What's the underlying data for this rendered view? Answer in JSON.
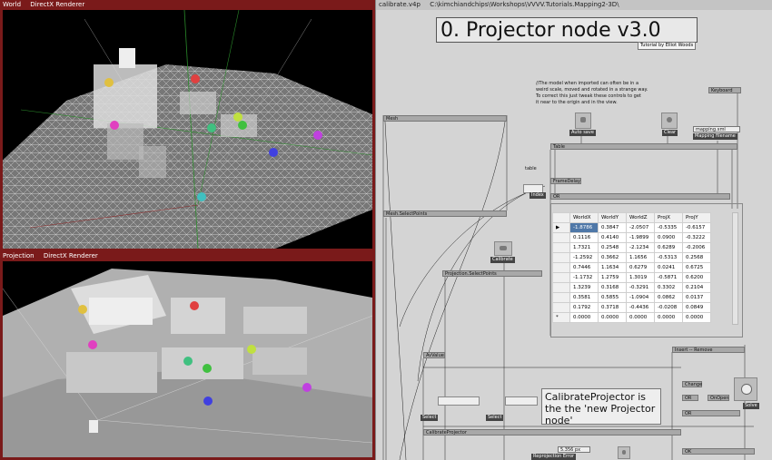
{
  "world_window": {
    "title": "World",
    "renderer": "DirectX Renderer"
  },
  "projection_window": {
    "title": "Projection",
    "renderer": "DirectX Renderer"
  },
  "patch_window": {
    "title": "calibrate.v4p",
    "path": "C:\\kimchiandchips\\Workshops\\VVVV.Tutorials.Mapping2-3D\\"
  },
  "patch": {
    "heading": "0. Projector node v3.0",
    "tutorial_by": "Tutorial by Elliot Woods",
    "comment_lines": [
      "//The model when imported can often be in a",
      "weird scale, moved and rotated in a strange way.",
      "To correct this just tweak these controls to get",
      "it near to the origin and in the view."
    ],
    "nodes": {
      "keyboard": "Keyboard",
      "mesh": "Mesh",
      "auto_save": "Auto save",
      "clear": "Clear",
      "mapping_file": "mapping.xml",
      "mapping_filename": "Mapping filename",
      "table": "Table",
      "table_label": "table",
      "frame_delay": "FrameDelay",
      "or_1": "OR",
      "index": "Index",
      "mesh_select": "Mesh.SelectPoints",
      "calibrate": "Calibrate",
      "proj_select": "Projection.SelectPoints",
      "insert_remove": "Insert -- Remove",
      "av_value": "AvValue",
      "select_1": "Select",
      "select_2": "Select",
      "calibrate_projector": "CalibrateProjector",
      "change": "Change",
      "or_2": "OR",
      "onopen": "OnOpen",
      "or_3": "OR",
      "solve": "Solve",
      "ok": "OK",
      "reproj_value": "5.356 px",
      "reproj_error": "Reprojection Error"
    },
    "calibrate_comment": "CalibrateProjector is the the 'new Projector node'"
  },
  "grid": {
    "columns": [
      "WorldX",
      "WorldY",
      "WorldZ",
      "ProjX",
      "ProjY"
    ],
    "rows": [
      [
        "-1.8786",
        "0.3847",
        "-2.0507",
        "-0.5335",
        "-0.6157"
      ],
      [
        "0.1116",
        "0.4140",
        "-1.9899",
        "0.0900",
        "-0.3222"
      ],
      [
        "1.7321",
        "0.2548",
        "-2.1234",
        "0.6289",
        "-0.2006"
      ],
      [
        "-1.2592",
        "0.3662",
        "1.1656",
        "-0.5313",
        "0.2568"
      ],
      [
        "0.7446",
        "1.1634",
        "0.6279",
        "0.0241",
        "0.6725"
      ],
      [
        "-1.1732",
        "1.2759",
        "1.3019",
        "-0.5871",
        "0.6200"
      ],
      [
        "1.3239",
        "0.3168",
        "-0.3291",
        "0.3302",
        "0.2104"
      ],
      [
        "0.3581",
        "0.5855",
        "-1.0904",
        "0.0862",
        "0.0137"
      ],
      [
        "0.1792",
        "0.3718",
        "-0.4436",
        "-0.0208",
        "0.0849"
      ],
      [
        "0.0000",
        "0.0000",
        "0.0000",
        "0.0000",
        "0.0000"
      ]
    ],
    "new_row_marker": "*",
    "current_row_marker": "▶"
  },
  "colors": {
    "accent_red": "#7a1a1a",
    "selection": "#4f78a8"
  }
}
